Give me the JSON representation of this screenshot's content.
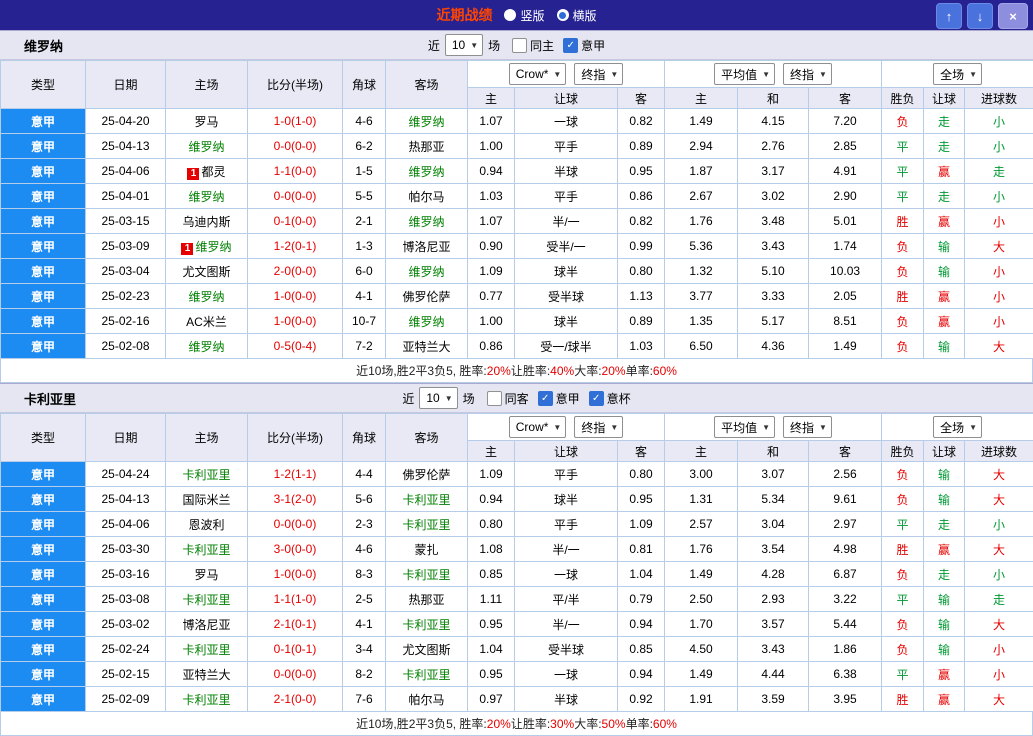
{
  "titlebar": {
    "title": "近期战绩",
    "radios": [
      {
        "label": "竖版",
        "selected": false
      },
      {
        "label": "横版",
        "selected": true
      }
    ],
    "buttons": {
      "up": "↑",
      "down": "↓",
      "close": "×"
    }
  },
  "table_headers": {
    "cols": [
      "类型",
      "日期",
      "主场",
      "比分(半场)",
      "角球",
      "客场"
    ],
    "asia": [
      "主",
      "让球",
      "客"
    ],
    "euro": [
      "主",
      "和",
      "客"
    ],
    "result": [
      "胜负",
      "让球",
      "进球数"
    ]
  },
  "colors": {
    "accent_blue": "#1d8cf2",
    "team_highlight": "#008000",
    "score_red": "#e60000",
    "result_green": "#009933",
    "titlebar_bg": "#262291",
    "title_red": "#ff4400"
  },
  "sections": [
    {
      "team": "维罗纳",
      "near": "近",
      "count": "10",
      "unit": "场",
      "checkboxes": [
        {
          "label": "同主",
          "checked": false
        },
        {
          "label": "意甲",
          "checked": true
        }
      ],
      "dropdowns": {
        "bookmaker": "Crow*",
        "asia_type": "终指",
        "euro_avg": "平均值",
        "euro_type": "终指",
        "scope": "全场"
      },
      "rows": [
        {
          "league": "意甲",
          "date": "25-04-20",
          "home": {
            "text": "罗马"
          },
          "score": "1-0(1-0)",
          "corner": "4-6",
          "away": {
            "text": "维罗纳",
            "hl": true
          },
          "odds": [
            "1.07",
            "一球",
            "0.82"
          ],
          "euro": [
            "1.49",
            "4.15",
            "7.20"
          ],
          "results": [
            {
              "t": "负",
              "c": "r"
            },
            {
              "t": "走",
              "c": "g"
            },
            {
              "t": "小",
              "c": "g"
            }
          ]
        },
        {
          "league": "意甲",
          "date": "25-04-13",
          "home": {
            "text": "维罗纳",
            "hl": true
          },
          "score": "0-0(0-0)",
          "corner": "6-2",
          "away": {
            "text": "热那亚"
          },
          "odds": [
            "1.00",
            "平手",
            "0.89"
          ],
          "euro": [
            "2.94",
            "2.76",
            "2.85"
          ],
          "results": [
            {
              "t": "平",
              "c": "g"
            },
            {
              "t": "走",
              "c": "g"
            },
            {
              "t": "小",
              "c": "g"
            }
          ]
        },
        {
          "league": "意甲",
          "date": "25-04-06",
          "home": {
            "text": "都灵",
            "badge": "1"
          },
          "score": "1-1(0-0)",
          "corner": "1-5",
          "away": {
            "text": "维罗纳",
            "hl": true
          },
          "odds": [
            "0.94",
            "半球",
            "0.95"
          ],
          "euro": [
            "1.87",
            "3.17",
            "4.91"
          ],
          "results": [
            {
              "t": "平",
              "c": "g"
            },
            {
              "t": "赢",
              "c": "r"
            },
            {
              "t": "走",
              "c": "g"
            }
          ]
        },
        {
          "league": "意甲",
          "date": "25-04-01",
          "home": {
            "text": "维罗纳",
            "hl": true
          },
          "score": "0-0(0-0)",
          "corner": "5-5",
          "away": {
            "text": "帕尔马"
          },
          "odds": [
            "1.03",
            "平手",
            "0.86"
          ],
          "euro": [
            "2.67",
            "3.02",
            "2.90"
          ],
          "results": [
            {
              "t": "平",
              "c": "g"
            },
            {
              "t": "走",
              "c": "g"
            },
            {
              "t": "小",
              "c": "g"
            }
          ]
        },
        {
          "league": "意甲",
          "date": "25-03-15",
          "home": {
            "text": "乌迪内斯"
          },
          "score": "0-1(0-0)",
          "corner": "2-1",
          "away": {
            "text": "维罗纳",
            "hl": true
          },
          "odds": [
            "1.07",
            "半/一",
            "0.82"
          ],
          "euro": [
            "1.76",
            "3.48",
            "5.01"
          ],
          "results": [
            {
              "t": "胜",
              "c": "r"
            },
            {
              "t": "赢",
              "c": "r"
            },
            {
              "t": "小",
              "c": "r"
            }
          ]
        },
        {
          "league": "意甲",
          "date": "25-03-09",
          "home": {
            "text": "维罗纳",
            "hl": true,
            "badge": "1"
          },
          "score": "1-2(0-1)",
          "corner": "1-3",
          "away": {
            "text": "博洛尼亚"
          },
          "odds": [
            "0.90",
            "受半/一",
            "0.99"
          ],
          "euro": [
            "5.36",
            "3.43",
            "1.74"
          ],
          "results": [
            {
              "t": "负",
              "c": "r"
            },
            {
              "t": "输",
              "c": "g"
            },
            {
              "t": "大",
              "c": "r"
            }
          ]
        },
        {
          "league": "意甲",
          "date": "25-03-04",
          "home": {
            "text": "尤文图斯"
          },
          "score": "2-0(0-0)",
          "corner": "6-0",
          "away": {
            "text": "维罗纳",
            "hl": true
          },
          "odds": [
            "1.09",
            "球半",
            "0.80"
          ],
          "euro": [
            "1.32",
            "5.10",
            "10.03"
          ],
          "results": [
            {
              "t": "负",
              "c": "r"
            },
            {
              "t": "输",
              "c": "g"
            },
            {
              "t": "小",
              "c": "r"
            }
          ]
        },
        {
          "league": "意甲",
          "date": "25-02-23",
          "home": {
            "text": "维罗纳",
            "hl": true
          },
          "score": "1-0(0-0)",
          "corner": "4-1",
          "away": {
            "text": "佛罗伦萨"
          },
          "odds": [
            "0.77",
            "受半球",
            "1.13"
          ],
          "euro": [
            "3.77",
            "3.33",
            "2.05"
          ],
          "results": [
            {
              "t": "胜",
              "c": "r"
            },
            {
              "t": "赢",
              "c": "r"
            },
            {
              "t": "小",
              "c": "r"
            }
          ]
        },
        {
          "league": "意甲",
          "date": "25-02-16",
          "home": {
            "text": "AC米兰"
          },
          "score": "1-0(0-0)",
          "corner": "10-7",
          "away": {
            "text": "维罗纳",
            "hl": true
          },
          "odds": [
            "1.00",
            "球半",
            "0.89"
          ],
          "euro": [
            "1.35",
            "5.17",
            "8.51"
          ],
          "results": [
            {
              "t": "负",
              "c": "r"
            },
            {
              "t": "赢",
              "c": "r"
            },
            {
              "t": "小",
              "c": "r"
            }
          ]
        },
        {
          "league": "意甲",
          "date": "25-02-08",
          "home": {
            "text": "维罗纳",
            "hl": true
          },
          "score": "0-5(0-4)",
          "corner": "7-2",
          "away": {
            "text": "亚特兰大"
          },
          "odds": [
            "0.86",
            "受一/球半",
            "1.03"
          ],
          "euro": [
            "6.50",
            "4.36",
            "1.49"
          ],
          "results": [
            {
              "t": "负",
              "c": "r"
            },
            {
              "t": "输",
              "c": "g"
            },
            {
              "t": "大",
              "c": "r"
            }
          ]
        }
      ],
      "summary": [
        {
          "t": "近10场,胜2平3负5, 胜率:",
          "c": "k"
        },
        {
          "t": "20%",
          "c": "r"
        },
        {
          "t": " 让胜率:",
          "c": "k"
        },
        {
          "t": "40%",
          "c": "r"
        },
        {
          "t": " 大率:",
          "c": "k"
        },
        {
          "t": "20%",
          "c": "r"
        },
        {
          "t": " 单率:",
          "c": "k"
        },
        {
          "t": "60%",
          "c": "r"
        }
      ]
    },
    {
      "team": "卡利亚里",
      "near": "近",
      "count": "10",
      "unit": "场",
      "checkboxes": [
        {
          "label": "同客",
          "checked": false
        },
        {
          "label": "意甲",
          "checked": true
        },
        {
          "label": "意杯",
          "checked": true
        }
      ],
      "dropdowns": {
        "bookmaker": "Crow*",
        "asia_type": "终指",
        "euro_avg": "平均值",
        "euro_type": "终指",
        "scope": "全场"
      },
      "rows": [
        {
          "league": "意甲",
          "date": "25-04-24",
          "home": {
            "text": "卡利亚里",
            "hl": true
          },
          "score": "1-2(1-1)",
          "corner": "4-4",
          "away": {
            "text": "佛罗伦萨"
          },
          "odds": [
            "1.09",
            "平手",
            "0.80"
          ],
          "euro": [
            "3.00",
            "3.07",
            "2.56"
          ],
          "results": [
            {
              "t": "负",
              "c": "r"
            },
            {
              "t": "输",
              "c": "g"
            },
            {
              "t": "大",
              "c": "r"
            }
          ]
        },
        {
          "league": "意甲",
          "date": "25-04-13",
          "home": {
            "text": "国际米兰"
          },
          "score": "3-1(2-0)",
          "corner": "5-6",
          "away": {
            "text": "卡利亚里",
            "hl": true
          },
          "odds": [
            "0.94",
            "球半",
            "0.95"
          ],
          "euro": [
            "1.31",
            "5.34",
            "9.61"
          ],
          "results": [
            {
              "t": "负",
              "c": "r"
            },
            {
              "t": "输",
              "c": "g"
            },
            {
              "t": "大",
              "c": "r"
            }
          ]
        },
        {
          "league": "意甲",
          "date": "25-04-06",
          "home": {
            "text": "恩波利"
          },
          "score": "0-0(0-0)",
          "corner": "2-3",
          "away": {
            "text": "卡利亚里",
            "hl": true
          },
          "odds": [
            "0.80",
            "平手",
            "1.09"
          ],
          "euro": [
            "2.57",
            "3.04",
            "2.97"
          ],
          "results": [
            {
              "t": "平",
              "c": "g"
            },
            {
              "t": "走",
              "c": "g"
            },
            {
              "t": "小",
              "c": "g"
            }
          ]
        },
        {
          "league": "意甲",
          "date": "25-03-30",
          "home": {
            "text": "卡利亚里",
            "hl": true
          },
          "score": "3-0(0-0)",
          "corner": "4-6",
          "away": {
            "text": "蒙扎"
          },
          "odds": [
            "1.08",
            "半/一",
            "0.81"
          ],
          "euro": [
            "1.76",
            "3.54",
            "4.98"
          ],
          "results": [
            {
              "t": "胜",
              "c": "r"
            },
            {
              "t": "赢",
              "c": "r"
            },
            {
              "t": "大",
              "c": "r"
            }
          ]
        },
        {
          "league": "意甲",
          "date": "25-03-16",
          "home": {
            "text": "罗马"
          },
          "score": "1-0(0-0)",
          "corner": "8-3",
          "away": {
            "text": "卡利亚里",
            "hl": true
          },
          "odds": [
            "0.85",
            "一球",
            "1.04"
          ],
          "euro": [
            "1.49",
            "4.28",
            "6.87"
          ],
          "results": [
            {
              "t": "负",
              "c": "r"
            },
            {
              "t": "走",
              "c": "g"
            },
            {
              "t": "小",
              "c": "g"
            }
          ]
        },
        {
          "league": "意甲",
          "date": "25-03-08",
          "home": {
            "text": "卡利亚里",
            "hl": true
          },
          "score": "1-1(1-0)",
          "corner": "2-5",
          "away": {
            "text": "热那亚"
          },
          "odds": [
            "1.11",
            "平/半",
            "0.79"
          ],
          "euro": [
            "2.50",
            "2.93",
            "3.22"
          ],
          "results": [
            {
              "t": "平",
              "c": "g"
            },
            {
              "t": "输",
              "c": "g"
            },
            {
              "t": "走",
              "c": "g"
            }
          ]
        },
        {
          "league": "意甲",
          "date": "25-03-02",
          "home": {
            "text": "博洛尼亚"
          },
          "score": "2-1(0-1)",
          "corner": "4-1",
          "away": {
            "text": "卡利亚里",
            "hl": true
          },
          "odds": [
            "0.95",
            "半/一",
            "0.94"
          ],
          "euro": [
            "1.70",
            "3.57",
            "5.44"
          ],
          "results": [
            {
              "t": "负",
              "c": "r"
            },
            {
              "t": "输",
              "c": "g"
            },
            {
              "t": "大",
              "c": "r"
            }
          ]
        },
        {
          "league": "意甲",
          "date": "25-02-24",
          "home": {
            "text": "卡利亚里",
            "hl": true
          },
          "score": "0-1(0-1)",
          "corner": "3-4",
          "away": {
            "text": "尤文图斯"
          },
          "odds": [
            "1.04",
            "受半球",
            "0.85"
          ],
          "euro": [
            "4.50",
            "3.43",
            "1.86"
          ],
          "results": [
            {
              "t": "负",
              "c": "r"
            },
            {
              "t": "输",
              "c": "g"
            },
            {
              "t": "小",
              "c": "r"
            }
          ]
        },
        {
          "league": "意甲",
          "date": "25-02-15",
          "home": {
            "text": "亚特兰大"
          },
          "score": "0-0(0-0)",
          "corner": "8-2",
          "away": {
            "text": "卡利亚里",
            "hl": true
          },
          "odds": [
            "0.95",
            "一球",
            "0.94"
          ],
          "euro": [
            "1.49",
            "4.44",
            "6.38"
          ],
          "results": [
            {
              "t": "平",
              "c": "g"
            },
            {
              "t": "赢",
              "c": "r"
            },
            {
              "t": "小",
              "c": "r"
            }
          ]
        },
        {
          "league": "意甲",
          "date": "25-02-09",
          "home": {
            "text": "卡利亚里",
            "hl": true
          },
          "score": "2-1(0-0)",
          "corner": "7-6",
          "away": {
            "text": "帕尔马"
          },
          "odds": [
            "0.97",
            "半球",
            "0.92"
          ],
          "euro": [
            "1.91",
            "3.59",
            "3.95"
          ],
          "results": [
            {
              "t": "胜",
              "c": "r"
            },
            {
              "t": "赢",
              "c": "r"
            },
            {
              "t": "大",
              "c": "r"
            }
          ]
        }
      ],
      "summary": [
        {
          "t": "近10场,胜2平3负5, 胜率:",
          "c": "k"
        },
        {
          "t": "20%",
          "c": "r"
        },
        {
          "t": " 让胜率:",
          "c": "k"
        },
        {
          "t": "30%",
          "c": "r"
        },
        {
          "t": " 大率:",
          "c": "k"
        },
        {
          "t": "50%",
          "c": "r"
        },
        {
          "t": " 单率:",
          "c": "k"
        },
        {
          "t": "60%",
          "c": "r"
        }
      ]
    }
  ]
}
